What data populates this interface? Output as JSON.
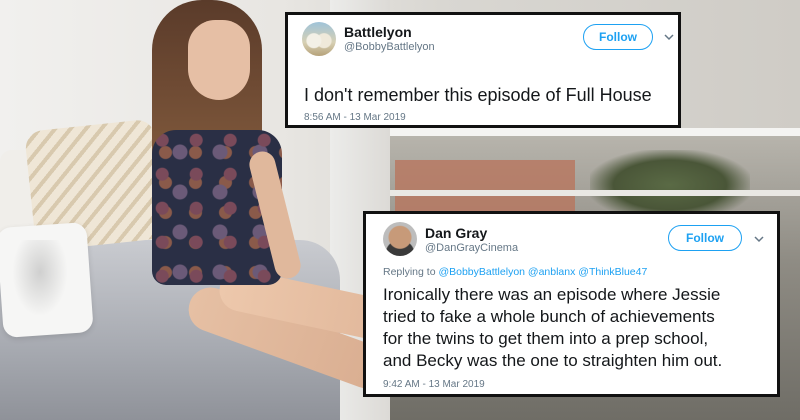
{
  "tweets": [
    {
      "name": "Battlelyon",
      "handle": "@BobbyBattlelyon",
      "follow_label": "Follow",
      "text": "I don't remember this episode of Full House",
      "time": "8:56 AM - 13 Mar 2019"
    },
    {
      "name": "Dan Gray",
      "handle": "@DanGrayCinema",
      "follow_label": "Follow",
      "reply_prefix": "Replying to ",
      "reply_mentions": [
        "@BobbyBattlelyon",
        "@anblanx",
        "@ThinkBlue47"
      ],
      "text_lines": [
        "Ironically there was an episode where Jessie",
        "tried to fake a whole bunch of achievements",
        "for the twins to get them into a prep school,",
        "and Becky was the one to straighten him out."
      ],
      "time": "9:42 AM - 13 Mar 2019"
    }
  ],
  "icons": {
    "chevron": "chevron-down-icon",
    "avatar": "avatar"
  },
  "colors": {
    "accent": "#1da1f2",
    "muted": "#657786",
    "text": "#14171a",
    "card_border": "#111111"
  }
}
